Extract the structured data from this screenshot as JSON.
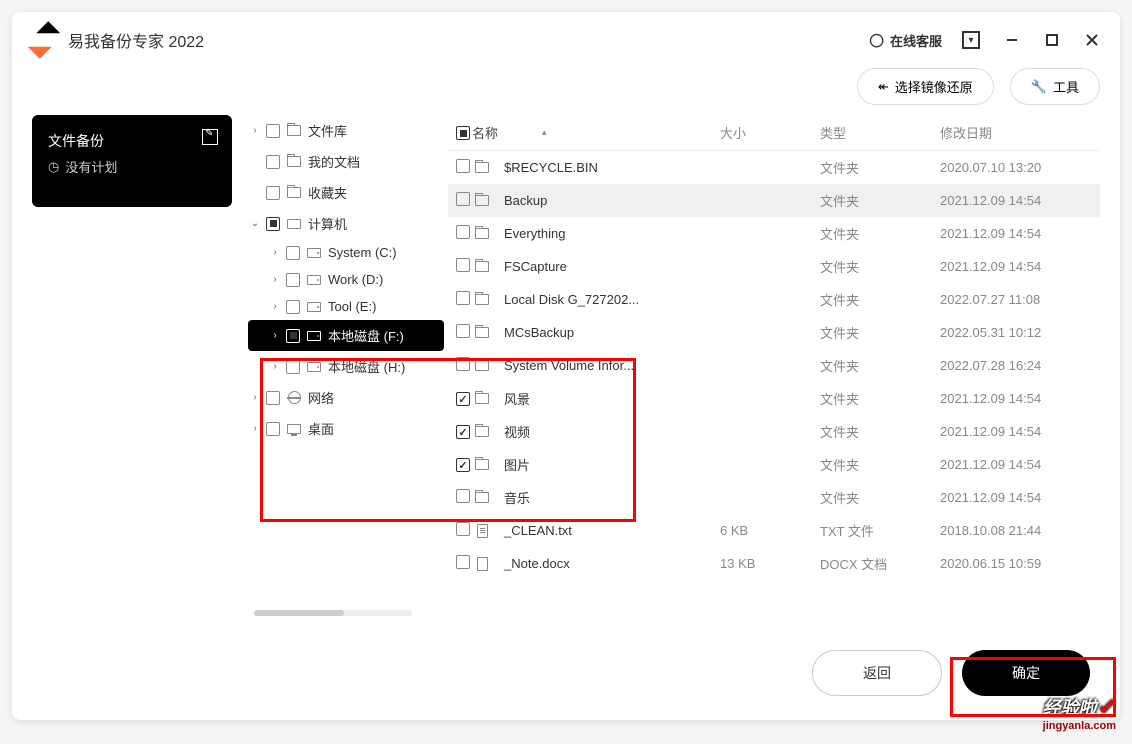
{
  "app": {
    "title": "易我备份专家 2022",
    "online_service": "在线客服"
  },
  "toolbar": {
    "restore": "选择镜像还原",
    "tools": "工具"
  },
  "sidebar": {
    "backup_title": "文件备份",
    "no_plan": "没有计划"
  },
  "tree": [
    {
      "label": "文件库",
      "indent": 0,
      "chev": "›",
      "cb": "",
      "icon": "folder"
    },
    {
      "label": "我的文档",
      "indent": 0,
      "chev": "",
      "cb": "",
      "icon": "folder"
    },
    {
      "label": "收藏夹",
      "indent": 0,
      "chev": "",
      "cb": "",
      "icon": "folder"
    },
    {
      "label": "计算机",
      "indent": 0,
      "chev": "⌄",
      "cb": "partial",
      "icon": "computer"
    },
    {
      "label": "System (C:)",
      "indent": 1,
      "chev": "›",
      "cb": "",
      "icon": "drive"
    },
    {
      "label": "Work (D:)",
      "indent": 1,
      "chev": "›",
      "cb": "",
      "icon": "drive"
    },
    {
      "label": "Tool (E:)",
      "indent": 1,
      "chev": "›",
      "cb": "",
      "icon": "drive"
    },
    {
      "label": "本地磁盘 (F:)",
      "indent": 1,
      "chev": "›",
      "cb": "partial",
      "icon": "drive",
      "selected": true
    },
    {
      "label": "本地磁盘 (H:)",
      "indent": 1,
      "chev": "›",
      "cb": "",
      "icon": "drive"
    },
    {
      "label": "网络",
      "indent": 0,
      "chev": "›",
      "cb": "",
      "icon": "globe"
    },
    {
      "label": "桌面",
      "indent": 0,
      "chev": "›",
      "cb": "",
      "icon": "desktop"
    }
  ],
  "columns": {
    "name": "名称",
    "size": "大小",
    "type": "类型",
    "date": "修改日期"
  },
  "files": [
    {
      "name": "$RECYCLE.BIN",
      "size": "",
      "type": "文件夹",
      "date": "2020.07.10 13:20",
      "cb": "",
      "icon": "folder"
    },
    {
      "name": "Backup",
      "size": "",
      "type": "文件夹",
      "date": "2021.12.09 14:54",
      "cb": "",
      "icon": "folder",
      "sel": true
    },
    {
      "name": "Everything",
      "size": "",
      "type": "文件夹",
      "date": "2021.12.09 14:54",
      "cb": "",
      "icon": "folder"
    },
    {
      "name": "FSCapture",
      "size": "",
      "type": "文件夹",
      "date": "2021.12.09 14:54",
      "cb": "",
      "icon": "folder"
    },
    {
      "name": "Local Disk G_727202...",
      "size": "",
      "type": "文件夹",
      "date": "2022.07.27 11:08",
      "cb": "",
      "icon": "folder"
    },
    {
      "name": "MCsBackup",
      "size": "",
      "type": "文件夹",
      "date": "2022.05.31 10:12",
      "cb": "",
      "icon": "folder"
    },
    {
      "name": "System Volume Infor...",
      "size": "",
      "type": "文件夹",
      "date": "2022.07.28 16:24",
      "cb": "",
      "icon": "folder"
    },
    {
      "name": "风景",
      "size": "",
      "type": "文件夹",
      "date": "2021.12.09 14:54",
      "cb": "checked",
      "icon": "folder"
    },
    {
      "name": "视频",
      "size": "",
      "type": "文件夹",
      "date": "2021.12.09 14:54",
      "cb": "checked",
      "icon": "folder"
    },
    {
      "name": "图片",
      "size": "",
      "type": "文件夹",
      "date": "2021.12.09 14:54",
      "cb": "checked",
      "icon": "folder"
    },
    {
      "name": "音乐",
      "size": "",
      "type": "文件夹",
      "date": "2021.12.09 14:54",
      "cb": "",
      "icon": "folder"
    },
    {
      "name": "_CLEAN.txt",
      "size": "6 KB",
      "type": "TXT 文件",
      "date": "2018.10.08 21:44",
      "cb": "",
      "icon": "txt"
    },
    {
      "name": "_Note.docx",
      "size": "13 KB",
      "type": "DOCX 文档",
      "date": "2020.06.15 10:59",
      "cb": "",
      "icon": "docx"
    }
  ],
  "footer": {
    "back": "返回",
    "confirm": "确定"
  },
  "watermark": {
    "text": "经验啦",
    "sub": "jingyanla.com"
  }
}
